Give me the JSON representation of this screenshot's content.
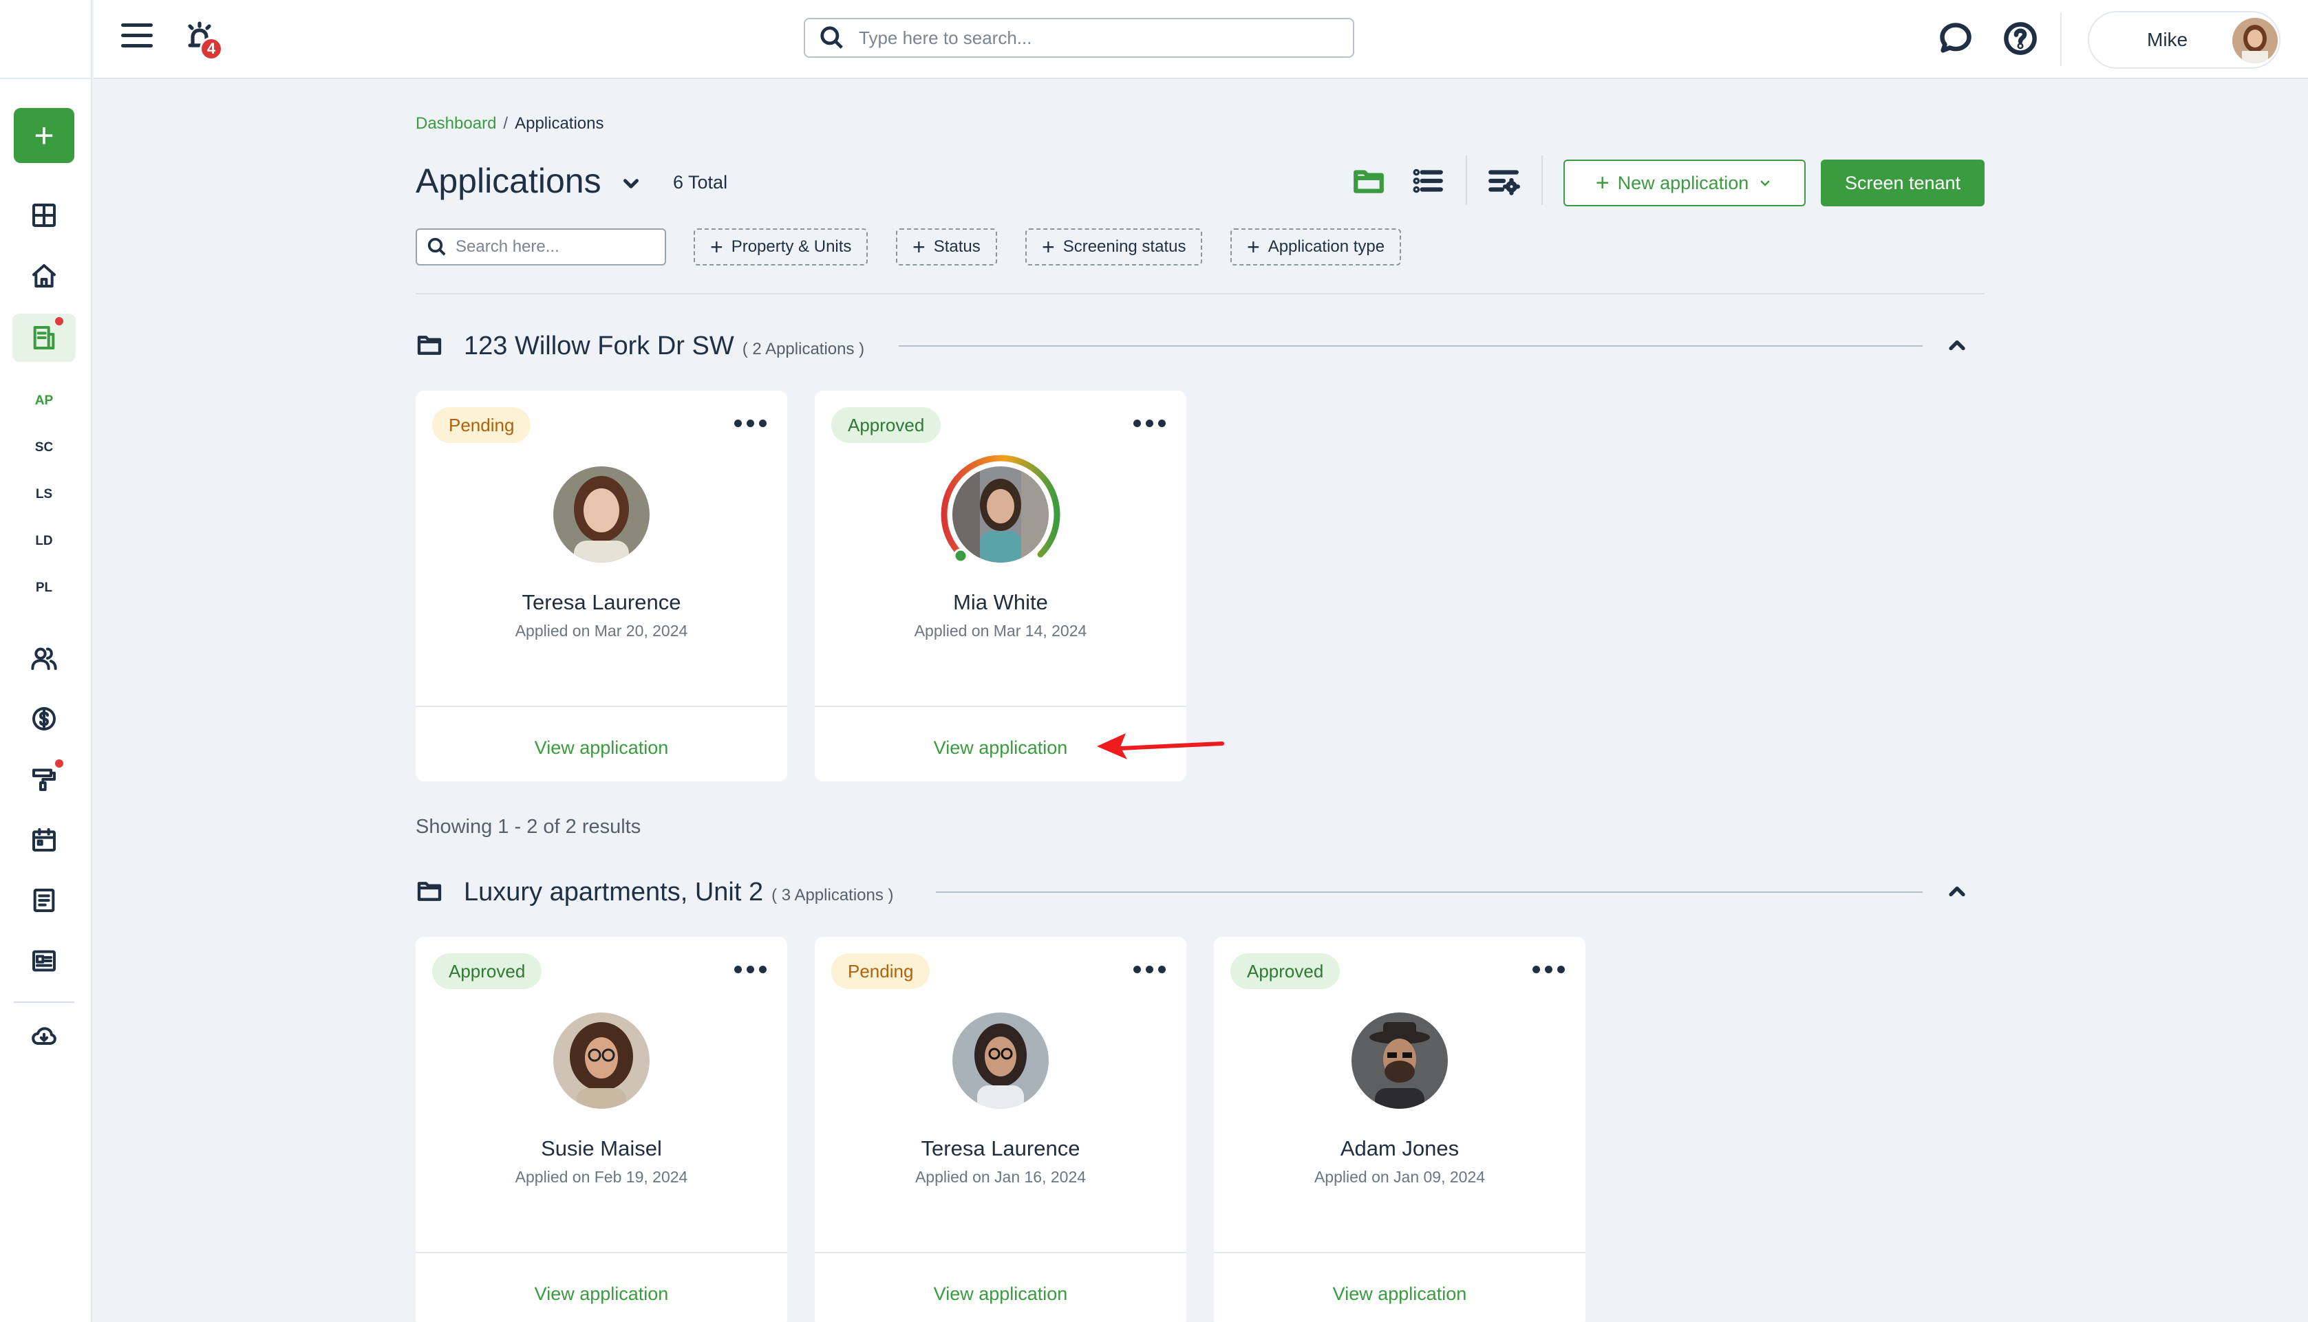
{
  "topbar": {
    "alarm_count": "4",
    "search_placeholder": "Type here to search...",
    "user_name": "Mike"
  },
  "rail": {
    "abbreviations": [
      "AP",
      "SC",
      "LS",
      "LD",
      "PL"
    ]
  },
  "breadcrumb": {
    "parent": "Dashboard",
    "separator": "/",
    "current": "Applications"
  },
  "page": {
    "title": "Applications",
    "total": "6 Total",
    "new_application": "New application",
    "screen_tenant": "Screen tenant"
  },
  "filters": {
    "search_placeholder": "Search here...",
    "chips": [
      "Property & Units",
      "Status",
      "Screening status",
      "Application type"
    ]
  },
  "groups": [
    {
      "name": "123 Willow Fork Dr SW",
      "count": "( 2 Applications )",
      "cards": [
        {
          "status": "Pending",
          "name": "Teresa Laurence",
          "date": "Applied on Mar 20, 2024",
          "link": "View application"
        },
        {
          "status": "Approved",
          "name": "Mia White",
          "date": "Applied on Mar 14, 2024",
          "link": "View application"
        }
      ],
      "showing": "Showing 1 - 2 of 2 results"
    },
    {
      "name": "Luxury apartments, Unit 2",
      "count": "( 3 Applications )",
      "cards": [
        {
          "status": "Approved",
          "name": "Susie Maisel",
          "date": "Applied on Feb 19, 2024",
          "link": "View application"
        },
        {
          "status": "Pending",
          "name": "Teresa Laurence",
          "date": "Applied on Jan 16, 2024",
          "link": "View application"
        },
        {
          "status": "Approved",
          "name": "Adam Jones",
          "date": "Applied on Jan 09, 2024",
          "link": "View application"
        }
      ]
    }
  ],
  "colors": {
    "brand_green": "#3a9b3f",
    "pending_bg": "#fdf1d6",
    "approved_bg": "#e3f3e1",
    "alert_red": "#d93636"
  }
}
